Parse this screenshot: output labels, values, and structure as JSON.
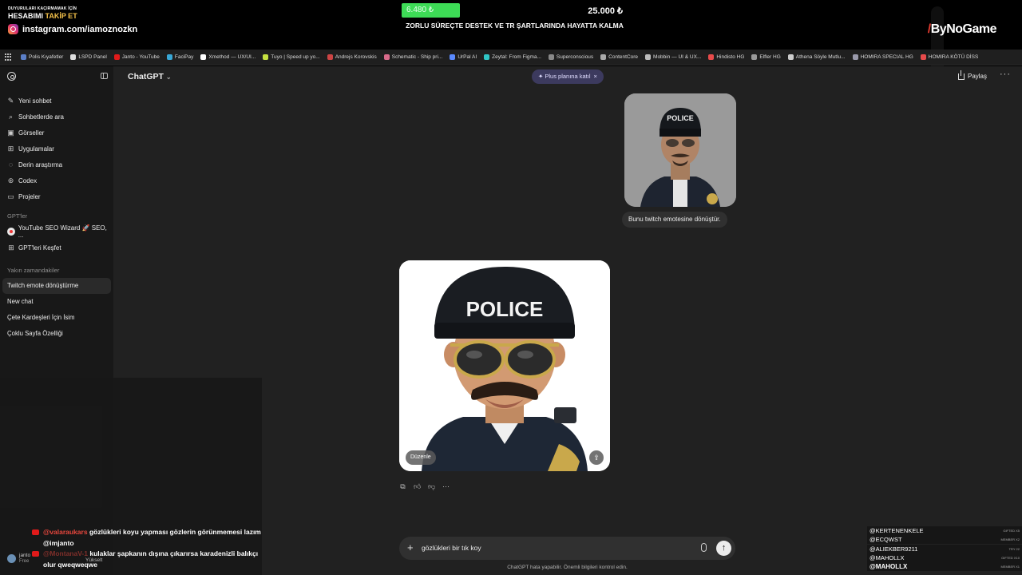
{
  "overlay": {
    "promo_line1": "DUYURULARI KAÇIRMAMAK İÇİN",
    "promo_line2_a": "HESABIMI ",
    "promo_line2_b": "TAKİP ET",
    "instagram": "instagram.com/iamoznozkn",
    "goal_current": "6.480 ₺",
    "goal_target": "25.000 ₺",
    "goal_progress": 0.26,
    "goal_text": "ZORLU SÜREÇTE DESTEK VE TR ŞARTLARINDA HAYATTA KALMA",
    "brand": "ByNoGame"
  },
  "bookmarks": [
    {
      "label": "Polis Kıyafetler",
      "color": "#5b7fc7"
    },
    {
      "label": "LSPD Panel",
      "color": "#dddddd"
    },
    {
      "label": "Janto - YouTube",
      "color": "#e01a1a"
    },
    {
      "label": "FaciPay",
      "color": "#38a7d6"
    },
    {
      "label": "Xmethod — UX/UI...",
      "color": "#ffffff"
    },
    {
      "label": "Tuyo | Speed up yo...",
      "color": "#c5e040"
    },
    {
      "label": "Andrejs Korovskis",
      "color": "#cc4444"
    },
    {
      "label": "Schematic - Ship pri...",
      "color": "#d86a8a"
    },
    {
      "label": "UrPal AI",
      "color": "#5a8aff"
    },
    {
      "label": "Zeytal: From Figma...",
      "color": "#2fc4c4"
    },
    {
      "label": "Superconscious",
      "color": "#888888"
    },
    {
      "label": "ContentCore",
      "color": "#aaaaaa"
    },
    {
      "label": "Mobbin — UI & UX...",
      "color": "#bbbbbb"
    },
    {
      "label": "Hindisto HG",
      "color": "#e84b4b"
    },
    {
      "label": "Elfler HG",
      "color": "#999999"
    },
    {
      "label": "Athena Söyle Mutlu...",
      "color": "#cccccc"
    },
    {
      "label": "HOMIRA SPECIAL HG",
      "color": "#9999aa"
    },
    {
      "label": "HOMIRA KÖTÜ DİSS",
      "color": "#e84b4b"
    }
  ],
  "sidebar": {
    "nav": [
      {
        "label": "Yeni sohbet",
        "icon": "✎"
      },
      {
        "label": "Sohbetlerde ara",
        "icon": "⌕"
      },
      {
        "label": "Görseller",
        "icon": "▣"
      },
      {
        "label": "Uygulamalar",
        "icon": "⊞"
      },
      {
        "label": "Derin araştırma",
        "icon": "◌"
      },
      {
        "label": "Codex",
        "icon": "⊛"
      },
      {
        "label": "Projeler",
        "icon": "▭"
      }
    ],
    "gpts_label": "GPT'ler",
    "gpts": [
      {
        "label": "YouTube SEO Wizard 🚀 SEO, ..."
      },
      {
        "label": "GPT'leri Keşfet"
      }
    ],
    "recent_label": "Yakın zamandakiler",
    "recent": [
      "Twitch emote dönüştürme",
      "New chat",
      "Çete Kardeşleri İçin İsim",
      "Çoklu Sayfa Özelliği"
    ]
  },
  "main": {
    "model_title": "ChatGPT",
    "plus_label": "✦ Plus planına katıl",
    "plus_close": "×",
    "share_label": "Paylaş",
    "more": "···",
    "user_message": "Bunu twitch emotesine dönüştür.",
    "edit_label": "Düzenle",
    "composer_text": "gözlükleri bir tık koy",
    "disclaimer": "ChatGPT hata yapabilir. Önemli bilgileri kontrol edin.",
    "image_badge_text": "POLICE"
  },
  "chat": [
    {
      "user": "@valaraukars",
      "msg": "gözlükleri koyu yapması gözlerin görünmemesi lazım @imjanto"
    },
    {
      "user": "@MontanaV-1",
      "msg": "kulaklar şapkanın dışına çıkarırsa karadenizli balıkçı olur qweqweqwe"
    }
  ],
  "chat_user": {
    "name": "janto",
    "status": "Free",
    "upgrade": "Yükselt"
  },
  "members": [
    {
      "name": "@KERTENENKELE",
      "badge": "GIFTED X5"
    },
    {
      "name": "@ECQWST",
      "badge": "MEMBER X2"
    },
    {
      "name": "@ALIEKBER9211",
      "badge": "TRY 22"
    },
    {
      "name": "@MAHOLLX",
      "badge": "GIFTED X10"
    },
    {
      "name": "@MAHOLLX",
      "badge": "MEMBER X1"
    }
  ]
}
